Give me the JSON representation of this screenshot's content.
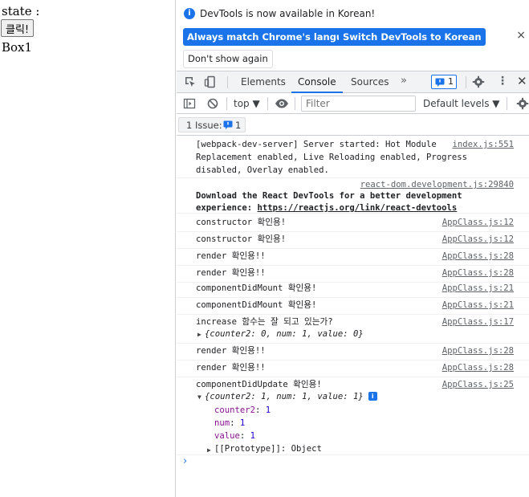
{
  "page": {
    "state_label": "state :",
    "click_button": "클릭!",
    "box_text": "Box1"
  },
  "infobar": {
    "message": "DevTools is now available in Korean!",
    "match_button": "Always match Chrome's language",
    "switch_button": "Switch DevTools to Korean",
    "dont_show_button": "Don't show again",
    "close": "×"
  },
  "tabs": {
    "elements": "Elements",
    "console": "Console",
    "sources": "Sources",
    "more": "»",
    "issues_count": "1"
  },
  "toolbar": {
    "context": "top ▼",
    "filter_placeholder": "Filter",
    "levels": "Default levels ▼"
  },
  "issues_bar": {
    "label": "1 Issue:",
    "count": "1"
  },
  "console": {
    "messages": [
      {
        "text": "[webpack-dev-server] Server started: Hot Module",
        "source": "index.js:551",
        "cont": [
          "Replacement enabled, Live Reloading enabled, Progress",
          "disabled, Overlay enabled."
        ]
      },
      {
        "source": "react-dom.development.js:29840",
        "line1": "Download the React DevTools for a better development",
        "line2_prefix": "experience: ",
        "line2_link": "https://reactjs.org/link/react-devtools"
      },
      {
        "text": "constructor 확인용!",
        "source": "AppClass.js:12"
      },
      {
        "text": "constructor 확인용!",
        "source": "AppClass.js:12"
      },
      {
        "text": "render 확인용!!",
        "source": "AppClass.js:28"
      },
      {
        "text": "render 확인용!!",
        "source": "AppClass.js:28"
      },
      {
        "text": "componentDidMount 확인용!",
        "source": "AppClass.js:21"
      },
      {
        "text": "componentDidMount 확인용!",
        "source": "AppClass.js:21"
      },
      {
        "text": "increase 함수는 잘 되고 있는가?",
        "source": "AppClass.js:17",
        "object": "{counter2: 0, num: 1, value: 0}"
      },
      {
        "text": "render 확인용!!",
        "source": "AppClass.js:28"
      },
      {
        "text": "render 확인용!!",
        "source": "AppClass.js:28"
      },
      {
        "text": "componentDidUpdate 확인용!",
        "source": "AppClass.js:25",
        "object": "{counter2: 1, num: 1, value: 1}",
        "props": [
          {
            "key": "counter2",
            "value": "1"
          },
          {
            "key": "num",
            "value": "1"
          },
          {
            "key": "value",
            "value": "1"
          }
        ],
        "prototype": "[[Prototype]]: Object"
      }
    ],
    "prompt": "›"
  },
  "colors": {
    "accent": "#1a73e8",
    "property_key": "#881391",
    "number": "#1c00cf"
  }
}
